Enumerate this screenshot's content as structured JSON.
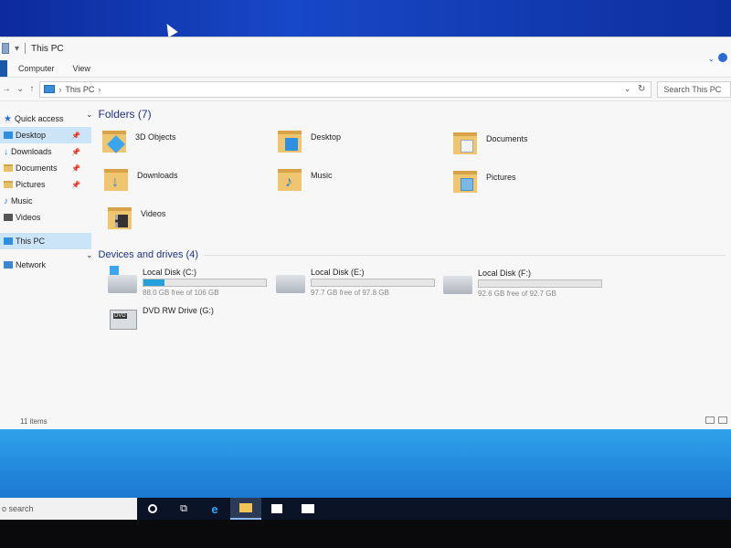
{
  "window": {
    "title": "This PC",
    "ribbon_tabs": [
      "Computer",
      "View"
    ],
    "address_path": "This PC",
    "search_placeholder": "Search This PC"
  },
  "nav": {
    "quick_access": "Quick access",
    "items": [
      {
        "label": "Desktop",
        "icon": "desktop-icon",
        "pinned": true
      },
      {
        "label": "Downloads",
        "icon": "downloads-icon",
        "pinned": true
      },
      {
        "label": "Documents",
        "icon": "documents-icon",
        "pinned": true
      },
      {
        "label": "Pictures",
        "icon": "pictures-icon",
        "pinned": true
      },
      {
        "label": "Music",
        "icon": "music-icon",
        "pinned": false
      },
      {
        "label": "Videos",
        "icon": "videos-icon",
        "pinned": false
      }
    ],
    "this_pc": "This PC",
    "network": "Network"
  },
  "folders": {
    "header": "Folders (7)",
    "items": [
      {
        "label": "3D Objects",
        "icon": "3d-objects-folder-icon"
      },
      {
        "label": "Desktop",
        "icon": "desktop-folder-icon"
      },
      {
        "label": "Documents",
        "icon": "documents-folder-icon"
      },
      {
        "label": "Downloads",
        "icon": "downloads-folder-icon"
      },
      {
        "label": "Music",
        "icon": "music-folder-icon"
      },
      {
        "label": "Pictures",
        "icon": "pictures-folder-icon"
      },
      {
        "label": "Videos",
        "icon": "videos-folder-icon"
      }
    ]
  },
  "drives": {
    "header": "Devices and drives (4)",
    "items": [
      {
        "name": "Local Disk (C:)",
        "free": "88.0 GB free of 106 GB",
        "used_fraction": 0.17
      },
      {
        "name": "Local Disk (E:)",
        "free": "97.7 GB free of 97.8 GB",
        "used_fraction": 0.0
      },
      {
        "name": "Local Disk (F:)",
        "free": "92.6 GB free of 92.7 GB",
        "used_fraction": 0.0
      }
    ],
    "dvd": {
      "name": "DVD RW Drive (G:)",
      "badge": "DVD"
    }
  },
  "status": {
    "count": "11 items"
  },
  "taskbar": {
    "search": "o search"
  }
}
